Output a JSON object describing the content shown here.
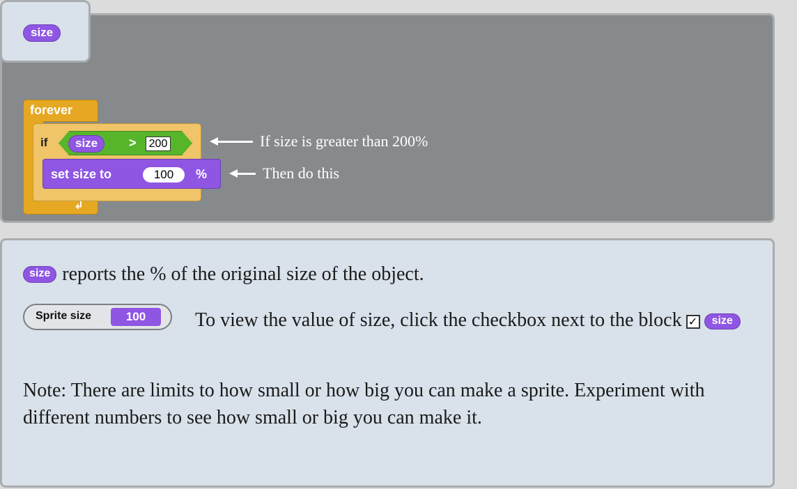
{
  "colors": {
    "motion_purple": "#8f56e3",
    "control_orange": "#e6a822",
    "operator_green": "#57b52c"
  },
  "tab": {
    "reporter": "size"
  },
  "script": {
    "hat_label": "forever",
    "loop_arrow": "↲",
    "if_label": "if",
    "predicate_reporter": "size",
    "operator": ">",
    "compare_value": "200",
    "command_label": "set size to",
    "command_value": "100",
    "command_unit": "%"
  },
  "annotations": {
    "if_note": "If size is greater than 200%",
    "then_note": "Then do this"
  },
  "info": {
    "reporter": "size",
    "line1_text": "reports the % of the original size of the object.",
    "watcher_label": "Sprite size",
    "watcher_value": "100",
    "view_text": "To view the value of size, click the checkbox next to the block",
    "checkbox_mark": "✓",
    "view_reporter": "size",
    "note": "Note: There are limits to how small or how big you can make a sprite. Experiment with different numbers to see how small or big you can make it."
  }
}
